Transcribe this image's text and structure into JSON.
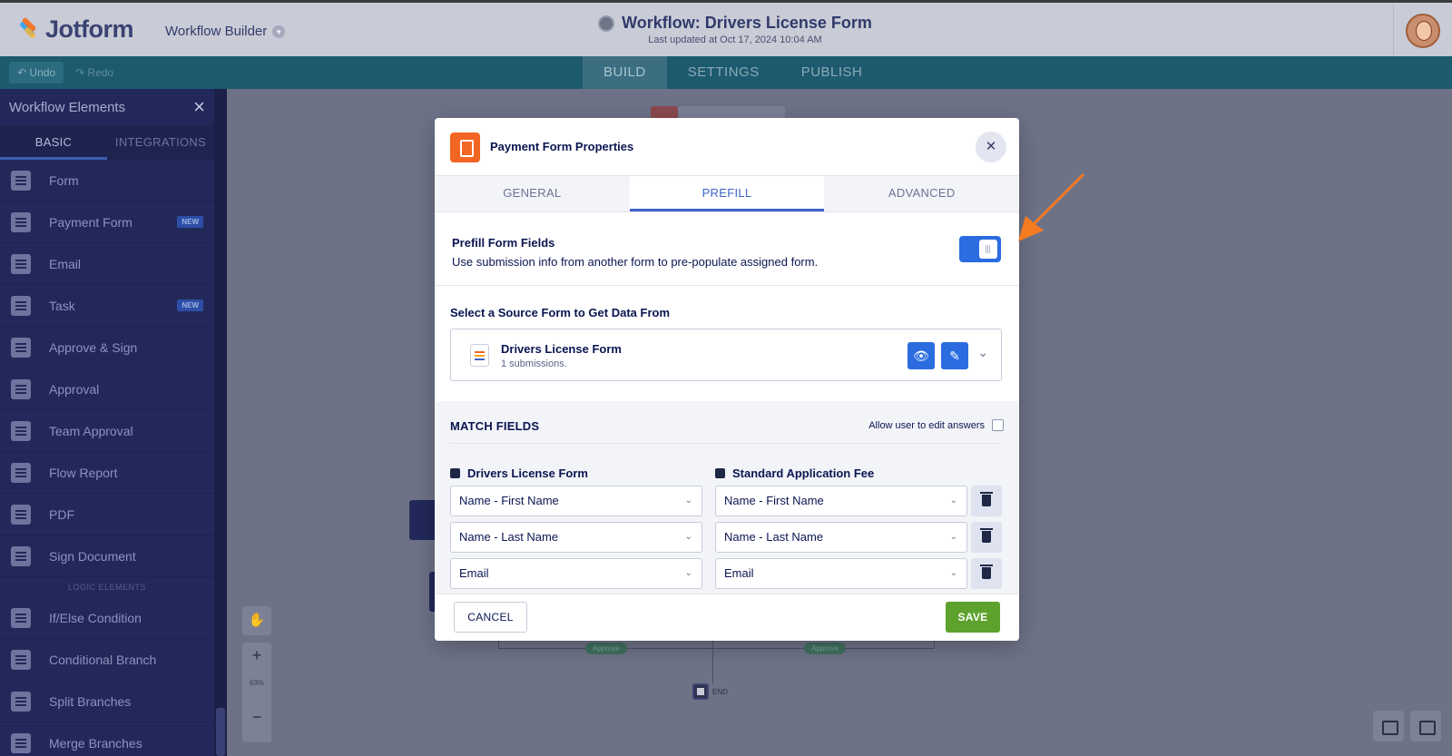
{
  "header": {
    "brand": "Jotform",
    "builder_label": "Workflow Builder",
    "title": "Workflow: Drivers License Form",
    "subtitle": "Last updated at Oct 17, 2024 10:04 AM"
  },
  "toolbar": {
    "undo_label": "Undo",
    "redo_label": "Redo",
    "tabs": [
      "BUILD",
      "SETTINGS",
      "PUBLISH"
    ],
    "active_tab": "BUILD"
  },
  "sidebar": {
    "title": "Workflow Elements",
    "tabs": [
      "BASIC",
      "INTEGRATIONS"
    ],
    "active_tab": "BASIC",
    "items": [
      {
        "label": "Form",
        "badge": ""
      },
      {
        "label": "Payment Form",
        "badge": "NEW"
      },
      {
        "label": "Email",
        "badge": ""
      },
      {
        "label": "Task",
        "badge": "NEW"
      },
      {
        "label": "Approve & Sign",
        "badge": ""
      },
      {
        "label": "Approval",
        "badge": ""
      },
      {
        "label": "Team Approval",
        "badge": ""
      },
      {
        "label": "Flow Report",
        "badge": ""
      },
      {
        "label": "PDF",
        "badge": ""
      },
      {
        "label": "Sign Document",
        "badge": ""
      }
    ],
    "logic_section": "LOGIC ELEMENTS",
    "logic_items": [
      {
        "label": "If/Else Condition"
      },
      {
        "label": "Conditional Branch"
      },
      {
        "label": "Split Branches"
      },
      {
        "label": "Merge Branches"
      }
    ]
  },
  "canvas": {
    "zoom_level": "63%",
    "approve_labels": [
      "Approve",
      "Approve"
    ],
    "end_label": "END"
  },
  "modal": {
    "title": "Payment Form Properties",
    "tabs": [
      "GENERAL",
      "PREFILL",
      "ADVANCED"
    ],
    "active_tab": "PREFILL",
    "prefill": {
      "title": "Prefill Form Fields",
      "description": "Use submission info from another form to pre-populate assigned form.",
      "enabled": true
    },
    "source": {
      "label": "Select a Source Form to Get Data From",
      "form_name": "Drivers License Form",
      "submissions": "1 submissions."
    },
    "match": {
      "title": "MATCH FIELDS",
      "allow_edit_label": "Allow user to edit answers",
      "allow_edit_checked": false,
      "left_header": "Drivers License Form",
      "right_header": "Standard Application Fee",
      "rows": [
        {
          "left": "Name - First Name",
          "right": "Name - First Name"
        },
        {
          "left": "Name - Last Name",
          "right": "Name - Last Name"
        },
        {
          "left": "Email",
          "right": "Email"
        }
      ]
    },
    "cancel_label": "CANCEL",
    "save_label": "SAVE"
  },
  "colors": {
    "brand_orange": "#f26522",
    "primary_blue": "#2b6de0",
    "save_green": "#5ea22e",
    "annotation_arrow": "#f47b20"
  }
}
